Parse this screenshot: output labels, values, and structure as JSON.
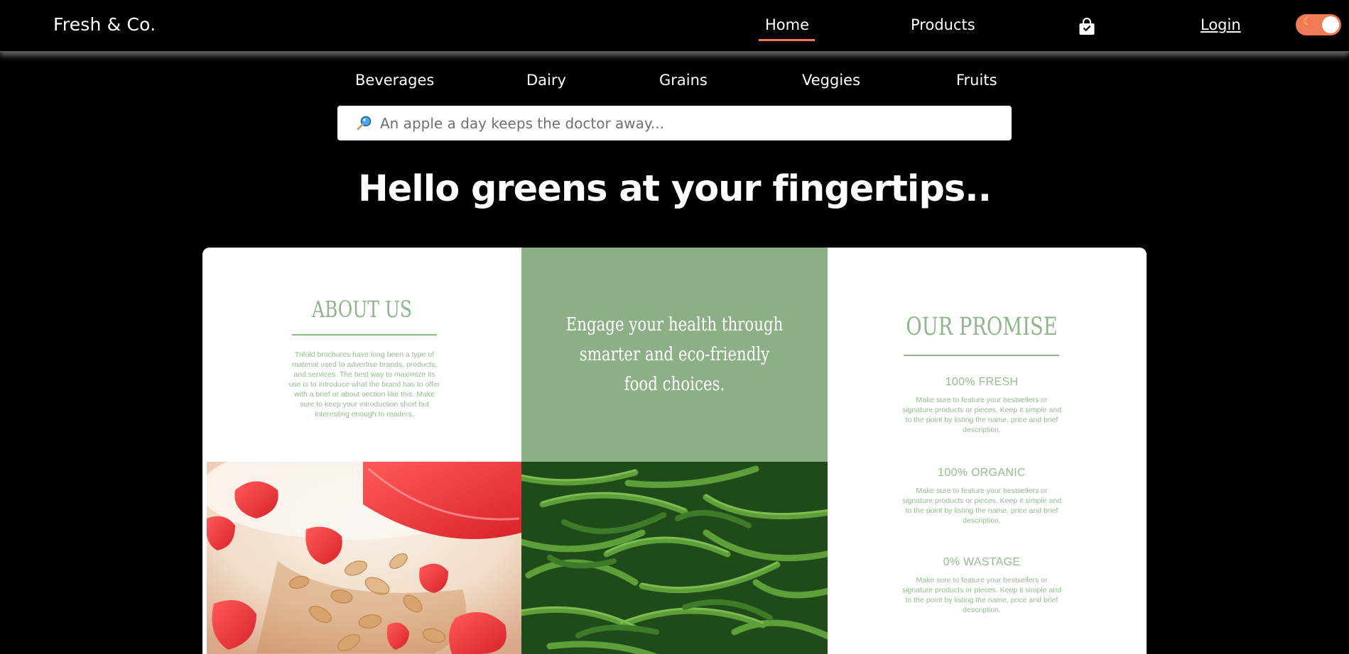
{
  "header": {
    "brand": "Fresh & Co.",
    "nav": {
      "home": "Home",
      "products": "Products",
      "login": "Login"
    },
    "accent_color": "#f07a55",
    "cart_icon": "shopping-bag-icon",
    "toggle_icon": "moon-icon",
    "toggle_on": true
  },
  "categories": [
    "Beverages",
    "Dairy",
    "Grains",
    "Veggies",
    "Fruits"
  ],
  "search": {
    "icon": "🔎",
    "placeholder": "An apple a day keeps the doctor away...",
    "value": ""
  },
  "hero": {
    "title": "Hello greens at your fingertips.."
  },
  "brochure": {
    "about": {
      "title": "ABOUT US",
      "body": "Trifold brochures have long been a type of material used to advertise brands, products, and services. The best way to maximize its use is to introduce what the brand has to offer with a brief or about section like this. Make sure to keep your introduction short but interesting enough to readers."
    },
    "quote": "Engage your health through smarter and eco-friendly food choices.",
    "promise": {
      "title": "OUR PROMISE",
      "items": [
        {
          "title": "100% FRESH",
          "body": "Make sure to feature your bestsellers or signature products or pieces. Keep it simple and to the point by listing the name, price and brief description."
        },
        {
          "title": "100% ORGANIC",
          "body": "Make sure to feature your bestsellers or signature products or pieces. Keep it simple and to the point by listing the name, price and brief description."
        },
        {
          "title": "0% WASTAGE",
          "body": "Make sure to feature your bestsellers or signature products or pieces. Keep it simple and to the point by listing the name, price and brief description."
        }
      ]
    },
    "accent_green": "#8daf85"
  }
}
